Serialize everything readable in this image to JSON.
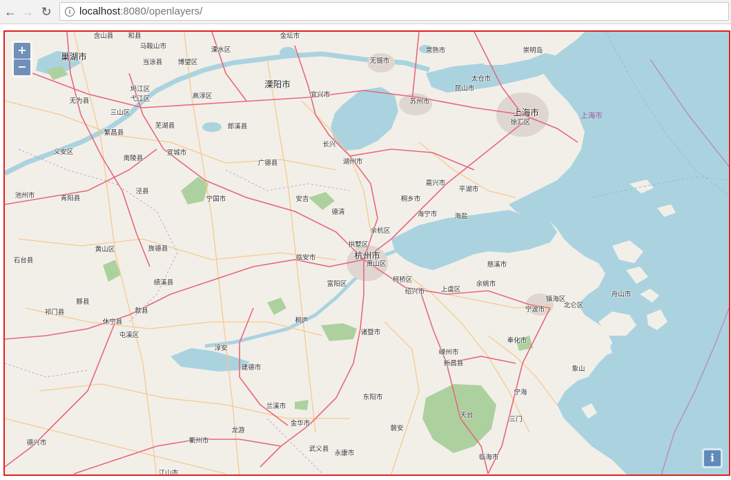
{
  "browser": {
    "back_icon": "arrow-left-icon",
    "forward_icon": "arrow-right-icon",
    "reload_icon": "reload-icon",
    "info_icon": "info-icon",
    "url_host": "localhost",
    "url_rest": ":8080/openlayers/"
  },
  "map": {
    "controls": {
      "zoom_in": "+",
      "zoom_out": "−",
      "attribution": "i"
    },
    "colors": {
      "land": "#f2efe9",
      "water": "#aad3df",
      "border": "#e02020",
      "major_road": "#e8667a",
      "minor_road": "#f7c98b"
    },
    "place_labels": [
      "含山县",
      "和县",
      "金坛市",
      "常熟市",
      "崇明岛",
      "巢湖市",
      "马鞍山市",
      "溧水区",
      "无锡市",
      "当涂县",
      "博望区",
      "太仓市",
      "溧阳市",
      "宜兴市",
      "昆山市",
      "鸠江区",
      "弋江区",
      "高淳区",
      "苏州市",
      "上海市",
      "无为县",
      "三山区",
      "芜湖县",
      "郎溪县",
      "徐汇区",
      "上海市",
      "繁昌县",
      "长兴",
      "义安区",
      "南陵县",
      "宣城市",
      "广德县",
      "湖州市",
      "嘉兴市",
      "平湖市",
      "泾县",
      "池州市",
      "青阳县",
      "宁国市",
      "安吉",
      "桐乡市",
      "德清",
      "海宁市",
      "海盐",
      "余杭区",
      "拱墅区",
      "黄山区",
      "旌德县",
      "杭州市",
      "临安市",
      "萧山区",
      "慈溪市",
      "石台县",
      "柯桥区",
      "富阳区",
      "绩溪县",
      "绍兴市",
      "上虞区",
      "余姚市",
      "镇海区",
      "舟山市",
      "黟县",
      "北仑区",
      "宁波市",
      "歙县",
      "祁门县",
      "休宁县",
      "桐庐",
      "屯溪区",
      "诸暨市",
      "奉化市",
      "淳安",
      "嵊州市",
      "建德市",
      "新昌县",
      "象山",
      "东阳市",
      "宁海",
      "兰溪市",
      "天台",
      "三门",
      "金华市",
      "磐安",
      "龙游",
      "德兴市",
      "衢州市",
      "武义县",
      "永康市",
      "临海市",
      "江山市"
    ]
  }
}
